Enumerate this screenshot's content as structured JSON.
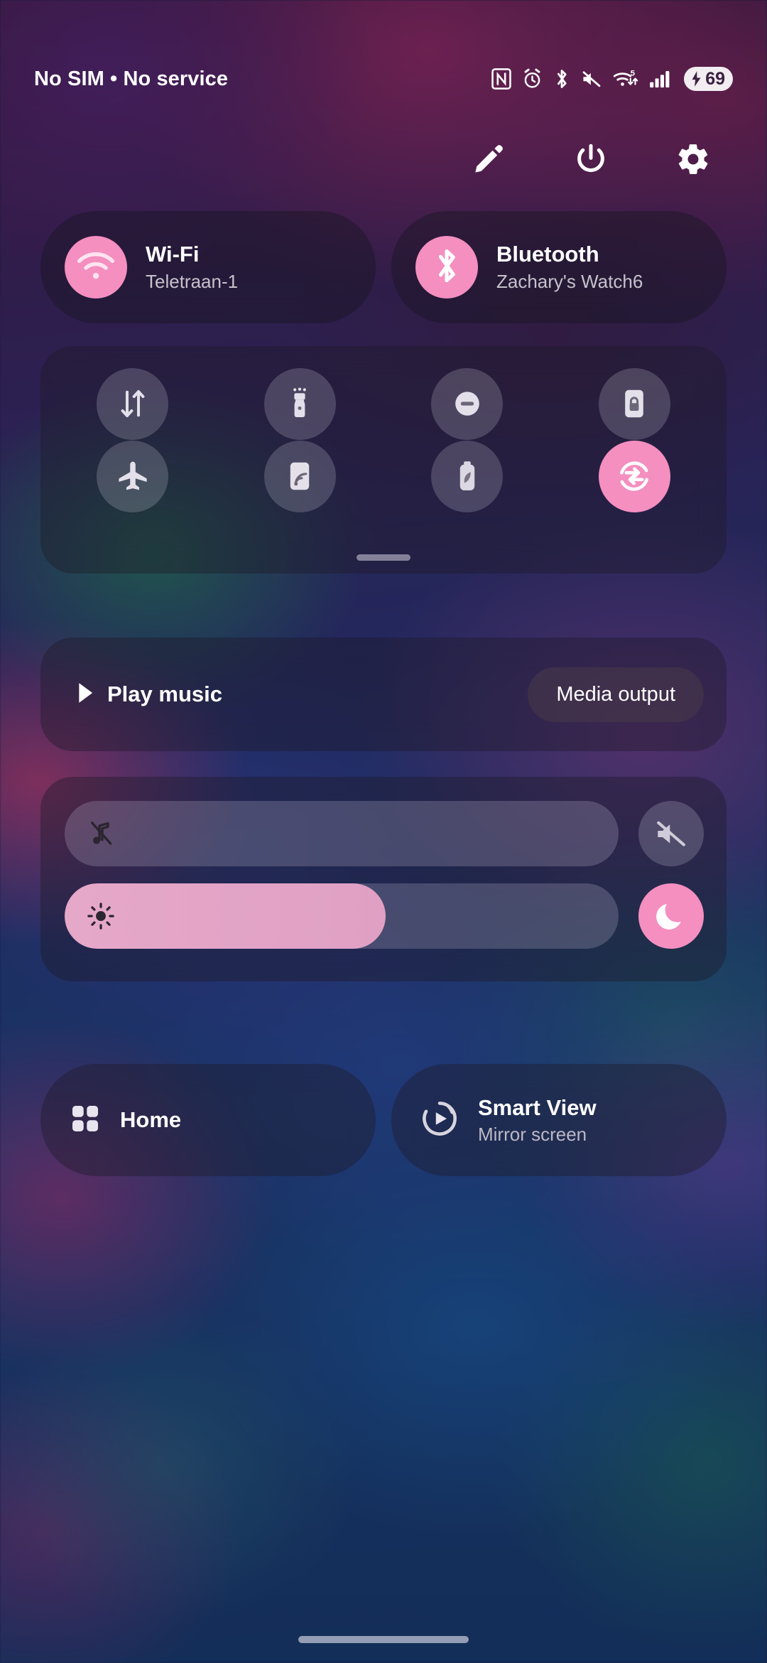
{
  "status_bar": {
    "carrier_text": "No SIM • No service",
    "icons": [
      "nfc-icon",
      "alarm-icon",
      "bluetooth-icon",
      "mute-icon",
      "wifi-5-icon",
      "signal-bars-icon"
    ],
    "wifi_generation_label": "5",
    "battery_percent": "69",
    "battery_charging": true
  },
  "header": {
    "edit_label": "Edit",
    "power_label": "Power off",
    "settings_label": "Settings"
  },
  "connectivity": {
    "wifi": {
      "title": "Wi-Fi",
      "subtitle": "Teletraan-1",
      "active": true,
      "icon": "wifi-icon"
    },
    "bluetooth": {
      "title": "Bluetooth",
      "subtitle": "Zachary's Watch6",
      "active": true,
      "icon": "bluetooth-icon"
    }
  },
  "toggles": {
    "row1": [
      {
        "name": "mobile-data",
        "label": "Mobile data",
        "icon": "data-arrows-icon",
        "active": false
      },
      {
        "name": "flashlight",
        "label": "Flashlight",
        "icon": "flashlight-icon",
        "active": false
      },
      {
        "name": "do-not-disturb",
        "label": "Do not disturb",
        "icon": "dnd-icon",
        "active": false
      },
      {
        "name": "auto-rotate",
        "label": "Auto rotate",
        "icon": "rotate-lock-icon",
        "active": false
      }
    ],
    "row2": [
      {
        "name": "airplane-mode",
        "label": "Airplane mode",
        "icon": "airplane-icon",
        "active": false
      },
      {
        "name": "nfc",
        "label": "NFC",
        "icon": "nfc-tile-icon",
        "active": false
      },
      {
        "name": "power-saving",
        "label": "Power saving",
        "icon": "battery-leaf-icon",
        "active": false
      },
      {
        "name": "sync",
        "label": "Sync",
        "icon": "sync-icon",
        "active": true
      }
    ],
    "drag_handle_label": "Expand quick settings"
  },
  "media": {
    "play_label": "Play music",
    "play_icon": "play-icon",
    "output_button_label": "Media output"
  },
  "sliders": {
    "volume": {
      "label": "Volume",
      "value_percent": 0,
      "icon": "music-note-muted-icon",
      "side_button": {
        "name": "mute-button",
        "label": "Mute",
        "icon": "speaker-mute-icon",
        "active": false
      }
    },
    "brightness": {
      "label": "Brightness",
      "value_percent": 58,
      "icon": "brightness-sun-icon",
      "side_button": {
        "name": "dark-mode-button",
        "label": "Dark mode",
        "icon": "moon-icon",
        "active": true
      }
    }
  },
  "bottom_tiles": [
    {
      "name": "home",
      "title": "Home",
      "subtitle": "",
      "icon": "grid-dots-icon",
      "active": false
    },
    {
      "name": "smart-view",
      "title": "Smart View",
      "subtitle": "Mirror screen",
      "icon": "smart-view-icon",
      "active": false
    }
  ],
  "colors": {
    "accent_pink": "#f48fc0",
    "text_primary": "#ffffff",
    "text_secondary": "#c6c2cc",
    "tile_inactive": "rgba(190,186,205,0.25)"
  }
}
